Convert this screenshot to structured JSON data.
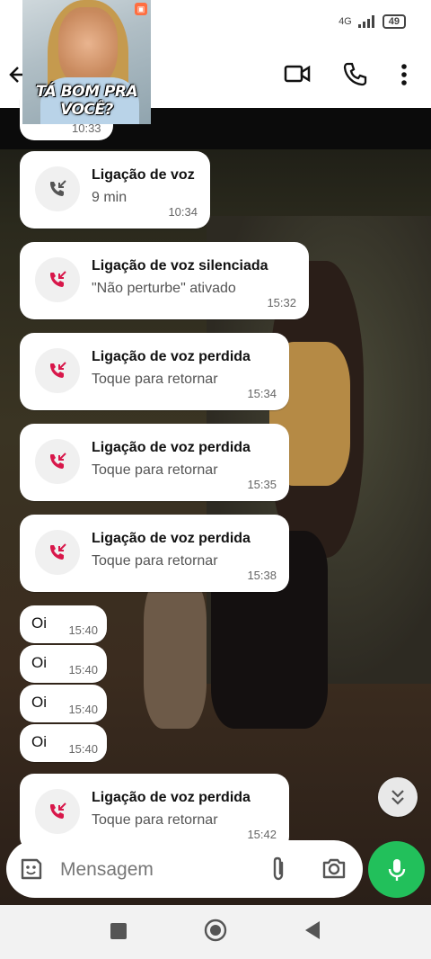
{
  "status_bar": {
    "network": "4G",
    "battery": "49"
  },
  "thumbnail": {
    "caption": "TÁ BOM PRA VOCÊ?"
  },
  "partial_message": {
    "time": "10:33"
  },
  "messages": [
    {
      "type": "call",
      "kind": "voice",
      "title": "Ligação de voz",
      "subtitle": "9 min",
      "time": "10:34"
    },
    {
      "type": "call",
      "kind": "missed",
      "title": "Ligação de voz silenciada",
      "subtitle": "\"Não perturbe\" ativado",
      "time": "15:32"
    },
    {
      "type": "call",
      "kind": "missed",
      "title": "Ligação de voz perdida",
      "subtitle": "Toque para retornar",
      "time": "15:34"
    },
    {
      "type": "call",
      "kind": "missed",
      "title": "Ligação de voz perdida",
      "subtitle": "Toque para retornar",
      "time": "15:35"
    },
    {
      "type": "call",
      "kind": "missed",
      "title": "Ligação de voz perdida",
      "subtitle": "Toque para retornar",
      "time": "15:38"
    },
    {
      "type": "text",
      "text": "Oi",
      "time": "15:40"
    },
    {
      "type": "text",
      "text": "Oi",
      "time": "15:40"
    },
    {
      "type": "text",
      "text": "Oi",
      "time": "15:40"
    },
    {
      "type": "text",
      "text": "Oi",
      "time": "15:40"
    },
    {
      "type": "call",
      "kind": "missed",
      "title": "Ligação de voz perdida",
      "subtitle": "Toque para retornar",
      "time": "15:42"
    }
  ],
  "composer": {
    "placeholder": "Mensagem"
  },
  "icons": {
    "back": "arrow-back-icon",
    "video": "video-call-icon",
    "phone": "phone-icon",
    "menu": "more-vert-icon",
    "sticker": "sticker-icon",
    "attach": "paperclip-icon",
    "camera": "camera-icon",
    "mic": "mic-icon",
    "scroll": "double-chevron-down-icon"
  },
  "colors": {
    "accent_green": "#22c05b",
    "missed_red": "#d8174a",
    "voice_gray": "#555555"
  }
}
